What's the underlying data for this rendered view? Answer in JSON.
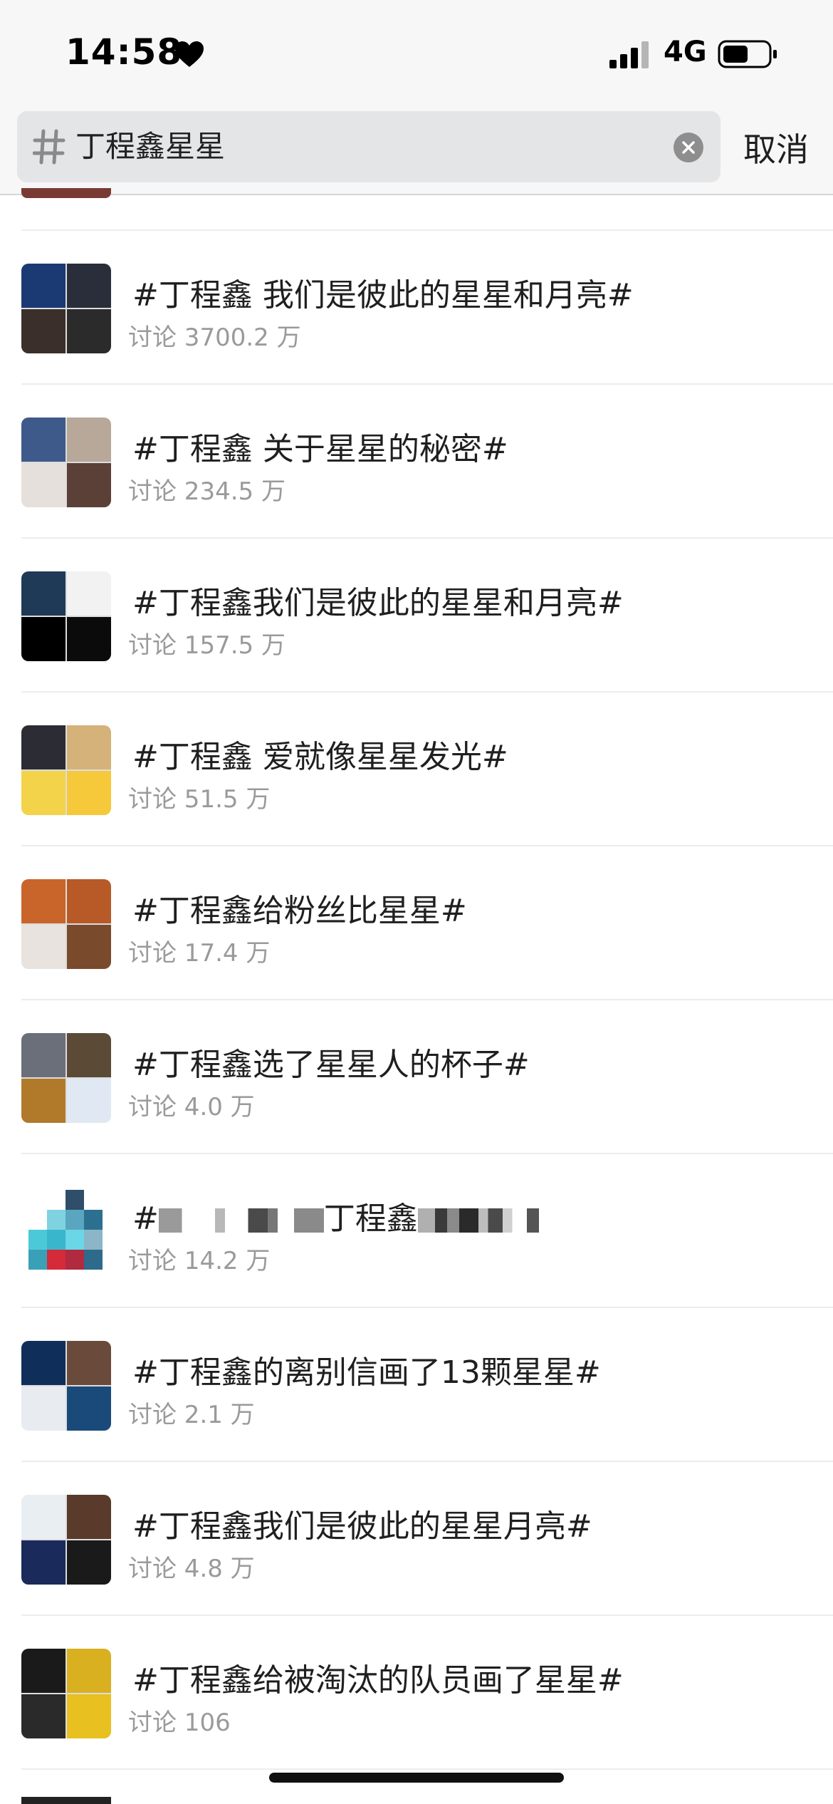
{
  "status_bar": {
    "time": "14:58",
    "network": "4G",
    "battery_level": 0.55
  },
  "search": {
    "query": "丁程鑫星星",
    "cancel_label": "取消"
  },
  "results": [
    {
      "title": "#丁程鑫 我们是彼此的星星和月亮#",
      "meta": "讨论 3700.2 万",
      "colors": [
        "#1b3a73",
        "#2a2d3a",
        "#3a2f2a",
        "#2b2b2b"
      ]
    },
    {
      "title": "#丁程鑫 关于星星的秘密#",
      "meta": "讨论 234.5 万",
      "colors": [
        "#3e5a8a",
        "#b8a89a",
        "#e6e0dc",
        "#5a4036"
      ]
    },
    {
      "title": "#丁程鑫我们是彼此的星星和月亮#",
      "meta": "讨论 157.5 万",
      "colors": [
        "#1f3a56",
        "#f2f2f2",
        "#000000",
        "#0b0b0b"
      ]
    },
    {
      "title": "#丁程鑫 爱就像星星发光#",
      "meta": "讨论 51.5 万",
      "colors": [
        "#2c2c34",
        "#d4b27a",
        "#f3d34a",
        "#f5c93a"
      ]
    },
    {
      "title": "#丁程鑫给粉丝比星星#",
      "meta": "讨论 17.4 万",
      "colors": [
        "#c9652a",
        "#b85a28",
        "#e8e3de",
        "#7a4a2c"
      ]
    },
    {
      "title": "#丁程鑫选了星星人的杯子#",
      "meta": "讨论 4.0 万",
      "colors": [
        "#6b6f7a",
        "#5a4a36",
        "#b07a2a",
        "#dfe8f3"
      ]
    },
    {
      "title": "#丁程鑫",
      "title_prefix": "#",
      "title_middle": "丁程鑫",
      "meta": "讨论 14.2 万",
      "colors": [
        "#4bc9d8",
        "#2e6a8a",
        "#d42a3a",
        "#8ab6c8"
      ]
    },
    {
      "title": "#丁程鑫的离别信画了13颗星星#",
      "meta": "讨论 2.1 万",
      "colors": [
        "#0f2f5a",
        "#6a4a3a",
        "#e8ecf0",
        "#1a4a7a"
      ]
    },
    {
      "title": "#丁程鑫我们是彼此的星星月亮#",
      "meta": "讨论 4.8 万",
      "colors": [
        "#e9eef3",
        "#5a3a2a",
        "#1a2a5a",
        "#1a1a1a"
      ]
    },
    {
      "title": "#丁程鑫给被淘汰的队员画了星星#",
      "meta": "讨论 106",
      "colors": [
        "#1a1a1a",
        "#d8b020",
        "#2a2a2a",
        "#e8c020"
      ]
    }
  ]
}
